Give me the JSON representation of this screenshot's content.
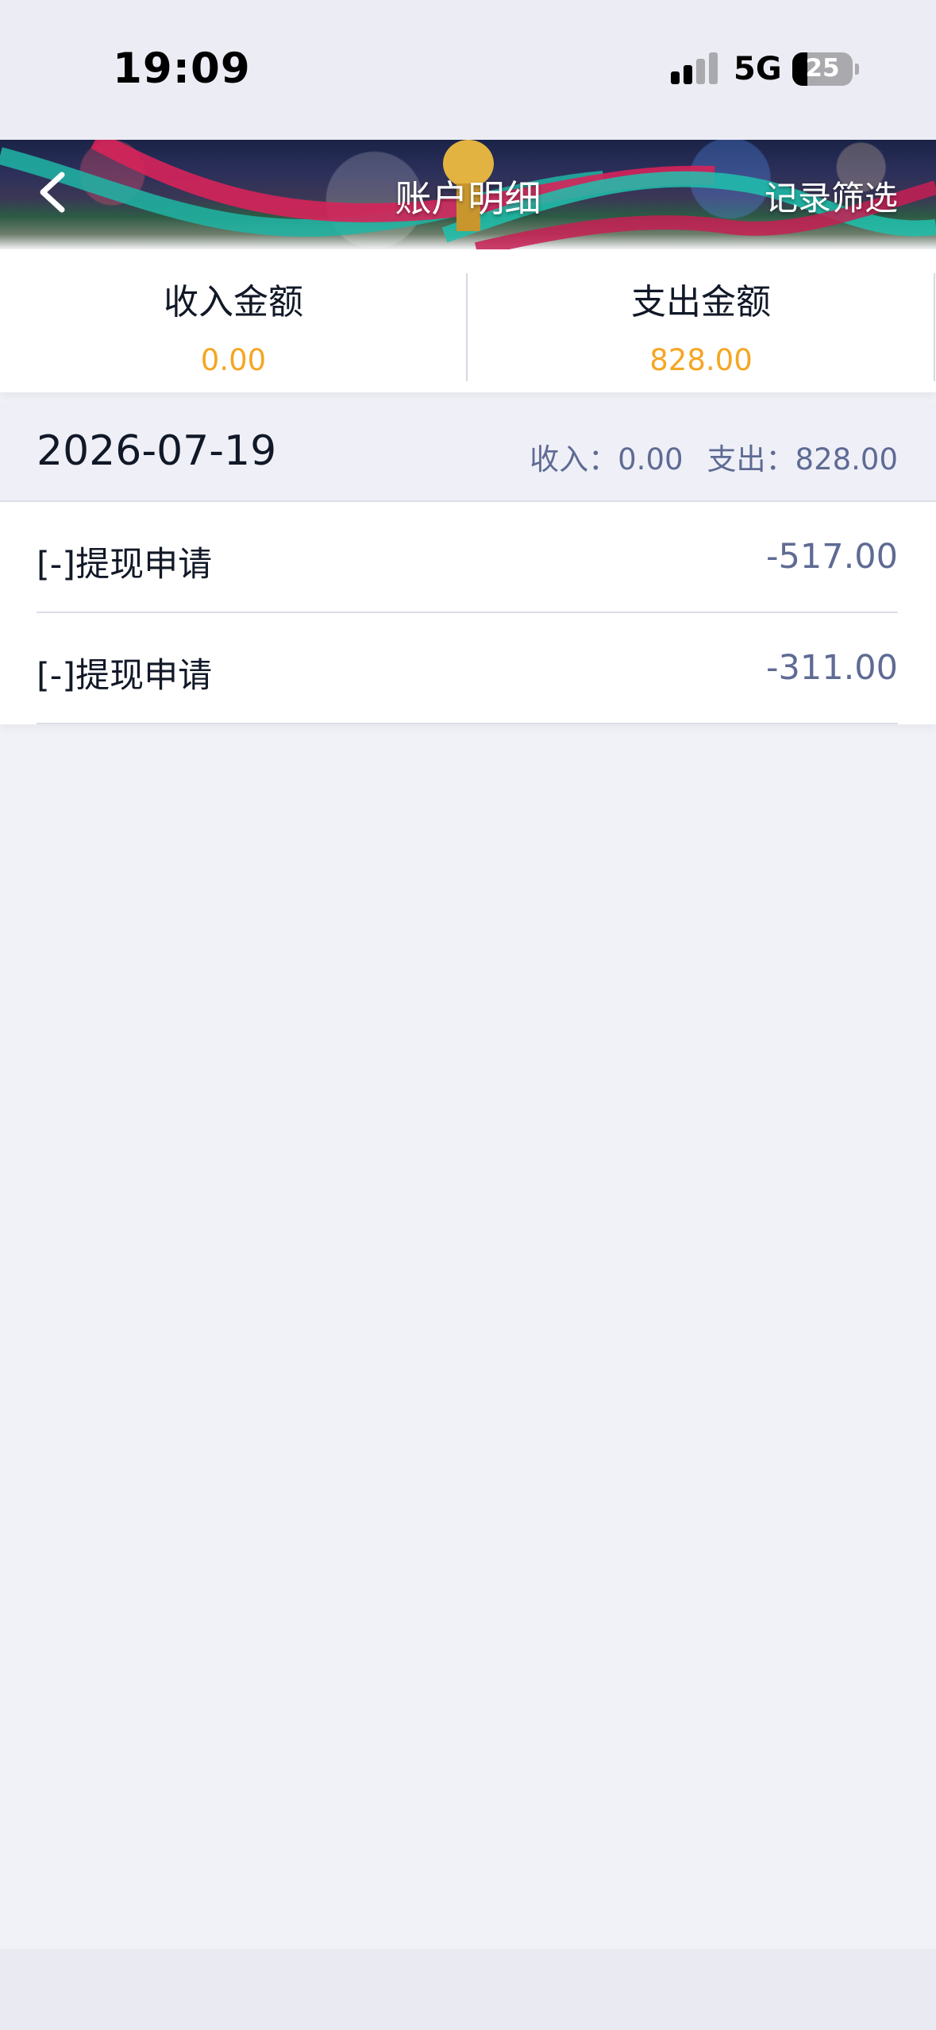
{
  "status_bar": {
    "time": "19:09",
    "network": "5G",
    "battery_percent": "25"
  },
  "header": {
    "title": "账户明细",
    "filter_label": "记录筛选"
  },
  "summary": {
    "income_label": "收入金额",
    "income_value": "0.00",
    "expense_label": "支出金额",
    "expense_value": "828.00",
    "value_color": "#f5a623"
  },
  "date_group": {
    "date": "2026-07-19",
    "income_text": "收入：0.00",
    "expense_text": "支出：828.00"
  },
  "records": [
    {
      "label": "[-]提现申请",
      "amount": "-517.00"
    },
    {
      "label": "[-]提现申请",
      "amount": "-311.00"
    }
  ],
  "colors": {
    "accent_amount": "#5f6b94",
    "page_background": "#f1f2f8"
  }
}
